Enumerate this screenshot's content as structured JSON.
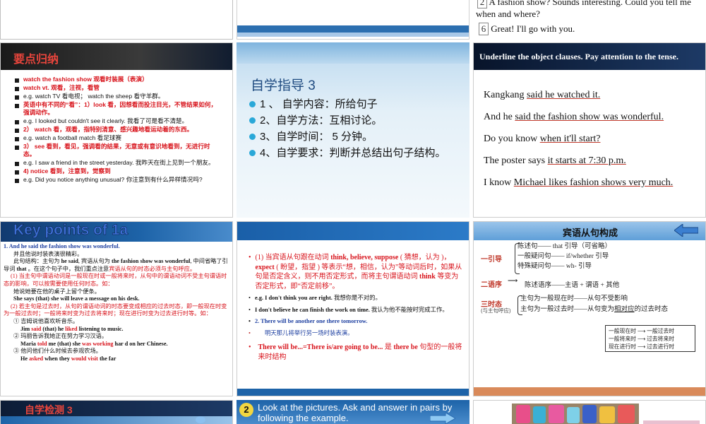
{
  "top_right": {
    "line1_num": "2",
    "line1_text": "A fashion show? Sounds interesting. Could you tell me",
    "line1_cont": "when and where?",
    "line2_num": "6",
    "line2_text": "Great! I'll go with you."
  },
  "s1": {
    "title": "要点归纳",
    "items": [
      {
        "text": "watch the fashion show  观看时装展（表演）",
        "red": true
      },
      {
        "text": "watch vt. 观看，注视，看管",
        "red": true
      },
      {
        "text": "e.g. watch TV 看电视；  watch the sheep  看守羊群。",
        "red": false
      },
      {
        "text": "英语中有不同的“看”：1）look  看，因想看而投注目光，不管结果如何，强调动作。",
        "red": true,
        "mixed": true
      },
      {
        "text": "e.g. I looked but couldn't see it clearly. 我看了可是看不清楚。",
        "red": false
      },
      {
        "text": "2）  watch  看，观看，指特别清意、感兴趣地看运动着的东西。",
        "red": true
      },
      {
        "text": "e.g. watch a football match  看足球赛",
        "red": false
      },
      {
        "text": "3）  see  看到，看见，强调看的结果，无意或有意识地看到，无进行时态。",
        "red": true
      },
      {
        "text": "e.g. I saw a friend in the street yesterday.  我昨天在街上见到一个朋友。",
        "red": false
      },
      {
        "text": "4) notice  看到，注意到，觉察到",
        "red": true
      },
      {
        "text": "e.g. Did you notice anything unusual?  你注意到有什么异样情况吗?",
        "red": false
      }
    ]
  },
  "s2": {
    "title": "自学指导 3",
    "items": [
      "1 、  自学内容：所给句子",
      "2、自学方法：互相讨论。",
      "3、自学时间：  5 分钟。",
      "4、自学要求：判断并总结出句子结构。"
    ]
  },
  "s3": {
    "title": "Underline the object clauses. Pay attention to the tense.",
    "sentences": [
      "Kangkang said he watched it.",
      "And he said  the fashion show was wonderful.",
      "Do you know when  it'll start?",
      "The poster says it starts at 7:30 p.m.",
      "I know Michael likes fashion shows very much."
    ]
  },
  "s4": {
    "title": "Key points of 1a",
    "lines": [
      "1. And he said the fashion show was wonderful.",
      "并且他说时装表演很精彩。",
      "此句结构：主句为 he said, 宾语从句为 the fashion show was wonderful, 中间省略了引导词 that 。在这个句子中，我们重点注意宾语从句的时态必须与主句呼应。",
      "(1) 当主句中谓语动词是一般现在时或一般将来时，从句中的谓语动词不受主句谓语时态的影响，可以按需要使用任何时态。如：",
      "她说她要在他的桌子上留个便条。",
      "She says (that) she will leave a message on his desk.",
      "(2) 若主句是过去时，从句的谓语动词的时态要变成相应的过去时态，即一般现在时变为一般过去时；一般将来时变为过去将来时；现在进行时变为过去进行时等。如：",
      "① 吉姆说他喜欢听音乐。",
      "Jim said (that) he liked listening to music.",
      "② 玛丽告诉我她正在努力学习汉语。",
      "Maria told me (that) she was working har d on her Chinese.",
      "③ 他问他们什么时候去参观农场。",
      "He asked when they would visit the far"
    ]
  },
  "s5": {
    "items": [
      "(1) 当宾语从句跟在动词 think, believe, suppose ( 猜想，认为 )， expect ( 盼望，指望 ) 等表示“想，相信，认为”等动词后时，如果从句是否定含义，则不用否定形式，而将主句谓语动词 think 等变为否定形式，即“否定前移”。",
      "e.g. I don't think you are right.  我想你是不对的。",
      "I don't believe he can finish the work on time.  我认为他不能按时完成工作。",
      "2. There will be another one there tomorrow.",
      "明天那儿将举行另一场时装表演。",
      "There will be...=There is/are going to be...    是 there be 句型的一般将来时结构"
    ]
  },
  "s6": {
    "title": "宾语从句构成",
    "g1_label": "一引导",
    "g1_items": [
      "陈述句—— that  引导（可省略）",
      "一般疑问句—— if/whether 引导",
      "特殊疑问句—— wh- 引导"
    ],
    "g2_label": "二语序",
    "g2_item": "陈述语序——主语 + 谓语 + 其他",
    "g3_label": "三时态",
    "g3_sub": "(与主句呼应)",
    "g3_items": [
      "主句为一般现在时——从句不受影响",
      "主句为一般过去时——从句变为相对应的过去时态"
    ],
    "table_left": [
      "一般现在时",
      "一般将来时",
      "现在进行时"
    ],
    "table_right": [
      "一般过去时",
      "过去将来时",
      "过去进行时"
    ]
  },
  "s7": {
    "title": "自学检测 3"
  },
  "s8": {
    "num": "2",
    "text": "Look at the pictures. Ask and answer in pairs by following the example."
  },
  "colors": {
    "dark": "#0f2340",
    "blue": "#1d63a8",
    "red": "#d8141c",
    "orange": "#d96b3c"
  }
}
